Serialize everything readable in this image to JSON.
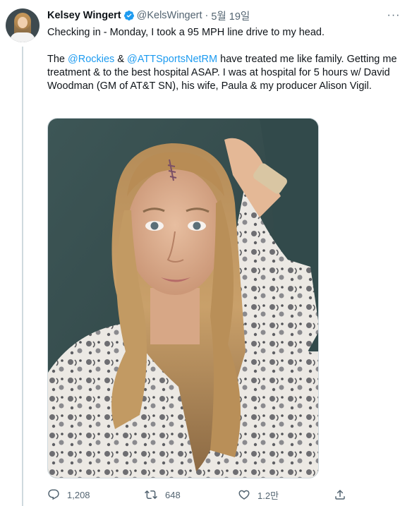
{
  "tweet": {
    "author_name": "Kelsey Wingert",
    "handle": "@KelsWingert",
    "separator": "·",
    "date": "5월 19일",
    "more_label": "···",
    "line1": "Checking in - Monday, I took a 95 MPH line drive to my head.",
    "para2_prefix": "The ",
    "mention1": "@Rockies",
    "para2_mid": " & ",
    "mention2": "@ATTSportsNetRM",
    "para2_rest": " have treated me like family. Getting me treatment & to the best hospital ASAP. I was at hospital for 5 hours w/ David Woodman (GM of AT&T SN), his wife, Paula & my producer Alison Vigil."
  },
  "actions": {
    "reply_count": "1,208",
    "retweet_count": "648",
    "like_count": "1.2만"
  },
  "colors": {
    "accent": "#1d9bf0",
    "secondary_text": "#536471",
    "primary_text": "#0f1419",
    "thread_line": "#cfd9de"
  },
  "icons": {
    "verified": "verified-badge-icon",
    "reply": "reply-icon",
    "retweet": "retweet-icon",
    "like": "heart-icon",
    "share": "share-icon",
    "more": "more-icon"
  }
}
